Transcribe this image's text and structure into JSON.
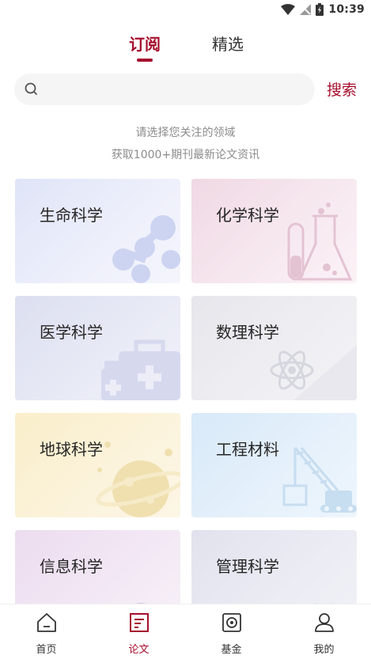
{
  "status_bar": {
    "time": "10:39"
  },
  "tabs": [
    {
      "label": "订阅",
      "active": true
    },
    {
      "label": "精选",
      "active": false
    }
  ],
  "search": {
    "placeholder": "",
    "button_label": "搜索"
  },
  "hint": {
    "line1": "请选择您关注的领域",
    "line2": "获取1000+期刊最新论文资讯"
  },
  "categories": [
    {
      "label": "生命科学",
      "icon": "molecule-icon"
    },
    {
      "label": "化学科学",
      "icon": "flask-icon"
    },
    {
      "label": "医学科学",
      "icon": "medical-kit-icon"
    },
    {
      "label": "数理科学",
      "icon": "atom-icon"
    },
    {
      "label": "地球科学",
      "icon": "planet-icon"
    },
    {
      "label": "工程材料",
      "icon": "crane-icon"
    },
    {
      "label": "信息科学",
      "icon": "cloud-icon"
    },
    {
      "label": "管理科学",
      "icon": "brain-icon"
    }
  ],
  "bottom_nav": [
    {
      "label": "首页",
      "icon": "home-icon",
      "active": false
    },
    {
      "label": "论文",
      "icon": "paper-icon",
      "active": true
    },
    {
      "label": "基金",
      "icon": "fund-icon",
      "active": false
    },
    {
      "label": "我的",
      "icon": "profile-icon",
      "active": false
    }
  ],
  "colors": {
    "accent": "#a50f2d",
    "hint_text": "#8c8c8c",
    "search_bg": "#f5f5f5"
  }
}
